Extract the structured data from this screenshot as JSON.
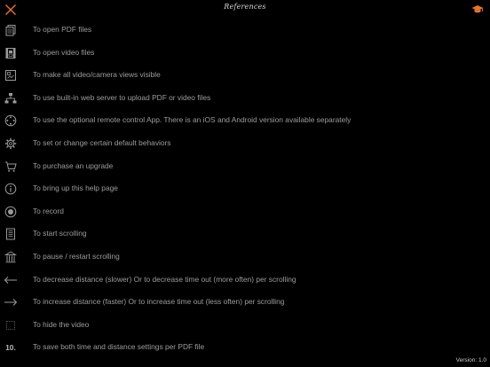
{
  "header": {
    "title": "References"
  },
  "colors": {
    "background": "#000000",
    "accent": "#e8732a",
    "text": "#9c9c9c",
    "icon": "#9a9a9a"
  },
  "items": [
    {
      "icon": "pdf-files-icon",
      "label": "To open PDF files"
    },
    {
      "icon": "video-files-icon",
      "label": "To open video files"
    },
    {
      "icon": "camera-views-icon",
      "label": "To make all video/camera views visible"
    },
    {
      "icon": "web-server-icon",
      "label": "To use built-in web server to upload PDF or video files"
    },
    {
      "icon": "remote-control-icon",
      "label": "To use the optional remote control App.  There is an iOS and Android version available separately"
    },
    {
      "icon": "gear-icon",
      "label": "To set or change certain default behaviors"
    },
    {
      "icon": "cart-icon",
      "label": "To purchase an upgrade"
    },
    {
      "icon": "info-icon",
      "label": "To bring up this help page"
    },
    {
      "icon": "record-icon",
      "label": "To record"
    },
    {
      "icon": "start-scroll-icon",
      "label": "To start scrolling"
    },
    {
      "icon": "pause-scroll-icon",
      "label": "To pause / restart scrolling"
    },
    {
      "icon": "arrow-left-icon",
      "label": "To decrease distance (slower) Or to decrease time out (more often) per scrolling"
    },
    {
      "icon": "arrow-right-icon",
      "label": "To increase distance (faster) Or to increase time out (less often) per scrolling"
    },
    {
      "icon": "hide-video-icon",
      "label": "To hide the video"
    },
    {
      "icon": "number-icon",
      "number": "10.",
      "label": "To save both time and distance settings per PDF file"
    }
  ],
  "footer": {
    "version": "Version: 1.0"
  }
}
